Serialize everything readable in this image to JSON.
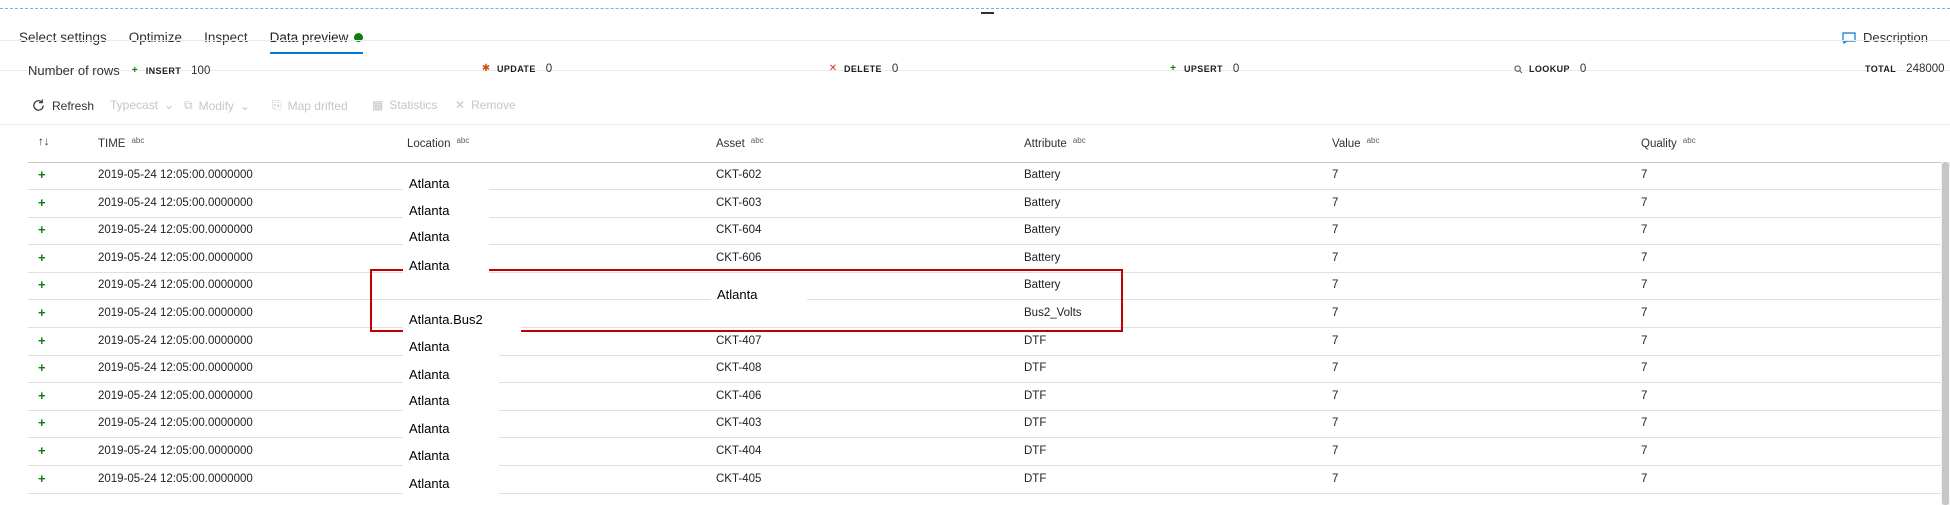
{
  "tabs": [
    {
      "label": "Select settings"
    },
    {
      "label": "Optimize"
    },
    {
      "label": "Inspect"
    },
    {
      "label": "Data preview",
      "status_color": "#107c10"
    }
  ],
  "description_label": "Description",
  "stats": {
    "rows_label": "Number of rows",
    "insert": {
      "label": "INSERT",
      "value": "100",
      "icon": "plus-icon",
      "color": "#107c10"
    },
    "update": {
      "label": "UPDATE",
      "value": "0",
      "icon": "asterisk-icon",
      "color": "#ca5010"
    },
    "delete": {
      "label": "DELETE",
      "value": "0",
      "icon": "x-icon",
      "color": "#d13438"
    },
    "upsert": {
      "label": "UPSERT",
      "value": "0",
      "icon": "upsert-icon",
      "color": "#107c10"
    },
    "lookup": {
      "label": "LOOKUP",
      "value": "0",
      "icon": "search-icon"
    },
    "total": {
      "label": "TOTAL",
      "value": "248000"
    }
  },
  "toolbar": {
    "refresh": "Refresh",
    "typecast": "Typecast",
    "modify": "Modify",
    "map_drifted": "Map drifted",
    "statistics": "Statistics",
    "remove": "Remove"
  },
  "columns": [
    {
      "name": "TIME",
      "type": "abc"
    },
    {
      "name": "Location",
      "type": "abc"
    },
    {
      "name": "Asset",
      "type": "abc"
    },
    {
      "name": "Attribute",
      "type": "abc"
    },
    {
      "name": "Value",
      "type": "abc"
    },
    {
      "name": "Quality",
      "type": "abc"
    }
  ],
  "rows": [
    {
      "time": "2019-05-24 12:05:00.0000000",
      "location": "Atlanta",
      "asset": "CKT-602",
      "attribute": "Battery",
      "value": "7",
      "quality": "7"
    },
    {
      "time": "2019-05-24 12:05:00.0000000",
      "location": "Atlanta",
      "asset": "CKT-603",
      "attribute": "Battery",
      "value": "7",
      "quality": "7"
    },
    {
      "time": "2019-05-24 12:05:00.0000000",
      "location": "Atlanta",
      "asset": "CKT-604",
      "attribute": "Battery",
      "value": "7",
      "quality": "7"
    },
    {
      "time": "2019-05-24 12:05:00.0000000",
      "location": "Atlanta",
      "asset": "CKT-606",
      "attribute": "Battery",
      "value": "7",
      "quality": "7"
    },
    {
      "time": "2019-05-24 12:05:00.0000000",
      "location": "",
      "asset": "Atlanta",
      "attribute": "Battery",
      "value": "7",
      "quality": "7"
    },
    {
      "time": "2019-05-24 12:05:00.0000000",
      "location": "Atlanta.Bus2",
      "asset": "",
      "attribute": "Bus2_Volts",
      "value": "7",
      "quality": "7"
    },
    {
      "time": "2019-05-24 12:05:00.0000000",
      "location": "Atlanta",
      "asset": "CKT-407",
      "attribute": "DTF",
      "value": "7",
      "quality": "7"
    },
    {
      "time": "2019-05-24 12:05:00.0000000",
      "location": "Atlanta",
      "asset": "CKT-408",
      "attribute": "DTF",
      "value": "7",
      "quality": "7"
    },
    {
      "time": "2019-05-24 12:05:00.0000000",
      "location": "Atlanta",
      "asset": "CKT-406",
      "attribute": "DTF",
      "value": "7",
      "quality": "7"
    },
    {
      "time": "2019-05-24 12:05:00.0000000",
      "location": "Atlanta",
      "asset": "CKT-403",
      "attribute": "DTF",
      "value": "7",
      "quality": "7"
    },
    {
      "time": "2019-05-24 12:05:00.0000000",
      "location": "Atlanta",
      "asset": "CKT-404",
      "attribute": "DTF",
      "value": "7",
      "quality": "7"
    },
    {
      "time": "2019-05-24 12:05:00.0000000",
      "location": "Atlanta",
      "asset": "CKT-405",
      "attribute": "DTF",
      "value": "7",
      "quality": "7"
    }
  ]
}
